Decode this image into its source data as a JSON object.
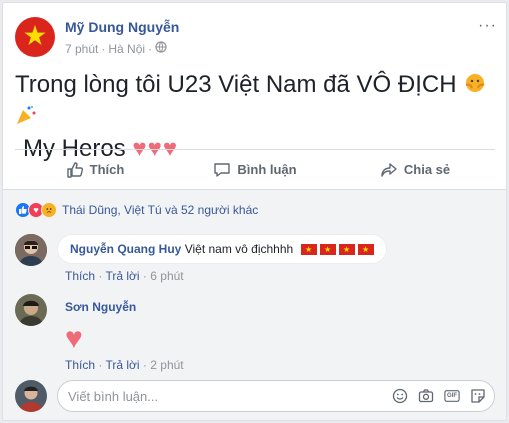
{
  "post": {
    "author": "Mỹ Dung Nguyễn",
    "meta_time": "7 phút",
    "meta_sep": "·",
    "meta_location": "Hà Nội",
    "meta_sep2": "·",
    "more_label": "···",
    "text_line1": "Trong lòng tôi U23 Việt Nam đã VÔ ĐỊCH",
    "text_line2": "My Heros",
    "hearts": "♥♥♥"
  },
  "actions": {
    "like_label": "Thích",
    "comment_label": "Bình luận",
    "share_label": "Chia sẻ"
  },
  "reactions": {
    "icons": [
      "like-icon",
      "love-icon",
      "sad-icon"
    ],
    "names": "Thái Dũng, Việt Tú và 52 người khác"
  },
  "comments": [
    {
      "author": "Nguyễn Quang Huy",
      "text": "Việt nam vô địchhhh",
      "flags": [
        "★",
        "★",
        "★",
        "★"
      ],
      "like_label": "Thích",
      "reply_label": "Trả lời",
      "dot": "·",
      "time": "6 phút"
    },
    {
      "author": "Sơn Nguyễn",
      "sticker": "♥",
      "like_label": "Thích",
      "reply_label": "Trả lời",
      "dot": "·",
      "time": "2 phút"
    }
  ],
  "composer": {
    "placeholder": "Viết bình luận...",
    "icons": [
      "emoji-icon",
      "camera-icon",
      "gif-icon",
      "sticker-icon"
    ],
    "gif_text": "GIF"
  },
  "colors": {
    "link": "#365899",
    "flag_red": "#da251d",
    "flag_star": "#ffde00",
    "heart": "#ef6b79"
  }
}
